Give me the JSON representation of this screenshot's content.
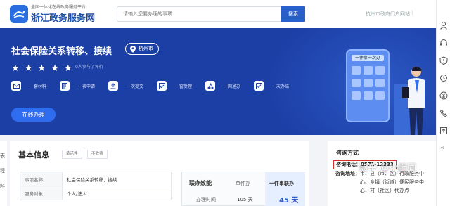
{
  "header": {
    "site_subtitle": "全国一体化在线政务服务平台",
    "site_title": "浙江政务服务网",
    "search_placeholder": "请输入您要办理的事项",
    "search_button": "搜索",
    "portal_link": "杭州市政府门户网站",
    "portal_extra": "|"
  },
  "banner": {
    "title": "社会保险关系转移、接续",
    "location": "杭州市",
    "rating_stars": 5,
    "rating_text": "0人参与了评价",
    "features": [
      {
        "label": "一套材料",
        "icon": "envelope-icon"
      },
      {
        "label": "一表申请",
        "icon": "form-icon"
      },
      {
        "label": "一次提交",
        "icon": "upload-icon"
      },
      {
        "label": "一窗受理",
        "icon": "window-icon"
      },
      {
        "label": "一网通办",
        "icon": "network-icon"
      },
      {
        "label": "一次办结",
        "icon": "check-icon"
      }
    ],
    "apply_button": "在线办理",
    "illustration_label": "一件事一次办"
  },
  "info": {
    "title": "基本信息",
    "tags": [
      "承诺件",
      "不收费"
    ],
    "rows": [
      {
        "key": "事项名称",
        "value": "社会保险关系转移、接续"
      },
      {
        "key": "服务对象",
        "value": "个人/法人"
      }
    ],
    "efficiency": {
      "header": "联办效能",
      "col1": "单件办",
      "col2": "一件事联办",
      "row_label": "办理时间",
      "v1": "105 天",
      "v2": "45 天"
    }
  },
  "left_tabs": [
    "表",
    "程",
    "料"
  ],
  "contact": {
    "title": "咨询方式",
    "phone_label": "咨询电话：",
    "phone": "0571-12333",
    "addr_label": "咨询地址：",
    "addr_1": "市、县（市、区）行政服务中",
    "addr_2": "心、乡镇（街道）便民服务中",
    "addr_3": "心、村（社区）代办点"
  },
  "watermark": "知乎 @小胖同",
  "sidebar_icons": [
    "user-icon",
    "headset-icon",
    "alert-icon",
    "history-icon",
    "yen-icon",
    "phone-icon",
    "upload-icon"
  ]
}
